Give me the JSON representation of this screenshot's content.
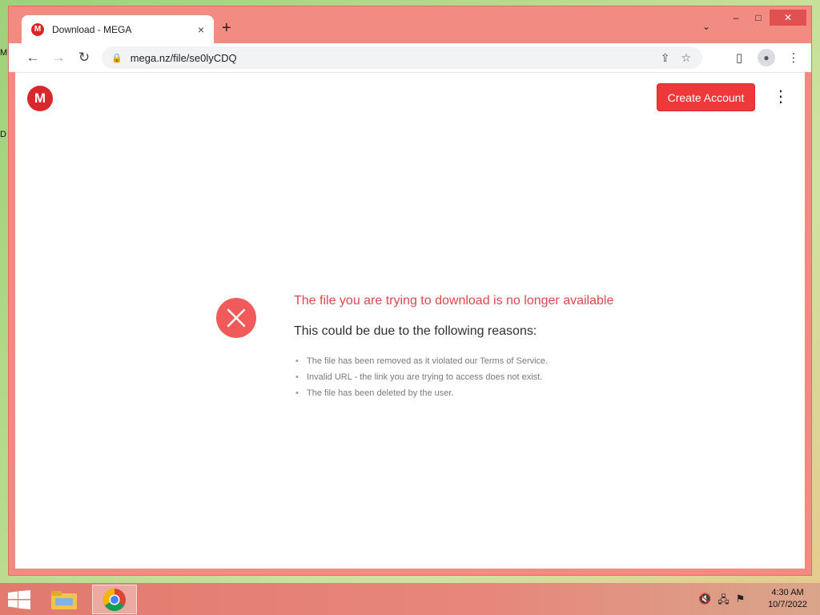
{
  "desktop": {
    "labels": [
      "M",
      "D"
    ]
  },
  "browser": {
    "tab": {
      "title": "Download - MEGA",
      "favicon_letter": "M",
      "close_icon": "×"
    },
    "new_tab_icon": "+",
    "tab_search_icon": "⌄",
    "window_controls": {
      "minimize": "–",
      "maximize": "□",
      "close": "✕"
    },
    "toolbar": {
      "back_icon": "←",
      "forward_icon": "→",
      "reload_icon": "↻",
      "lock_icon": "🔒",
      "url": "mega.nz/file/se0lyCDQ",
      "share_icon": "⇪",
      "bookmark_icon": "☆",
      "sidepanel_icon": "▯",
      "profile_icon": "●",
      "menu_icon": "⋮"
    }
  },
  "page": {
    "logo_letter": "M",
    "create_account_label": "Create Account",
    "more_menu_icon": "⋮",
    "error_title": "The file you are trying to download is no longer available",
    "error_subtitle": "This could be due to the following reasons:",
    "reasons": [
      "The file has been removed as it violated our Terms of Service.",
      "Invalid URL - the link you are trying to access does not exist.",
      "The file has been deleted by the user."
    ],
    "accent_color": "#f0373a"
  },
  "taskbar": {
    "clock_time": "4:30 AM",
    "clock_date": "10/7/2022"
  }
}
